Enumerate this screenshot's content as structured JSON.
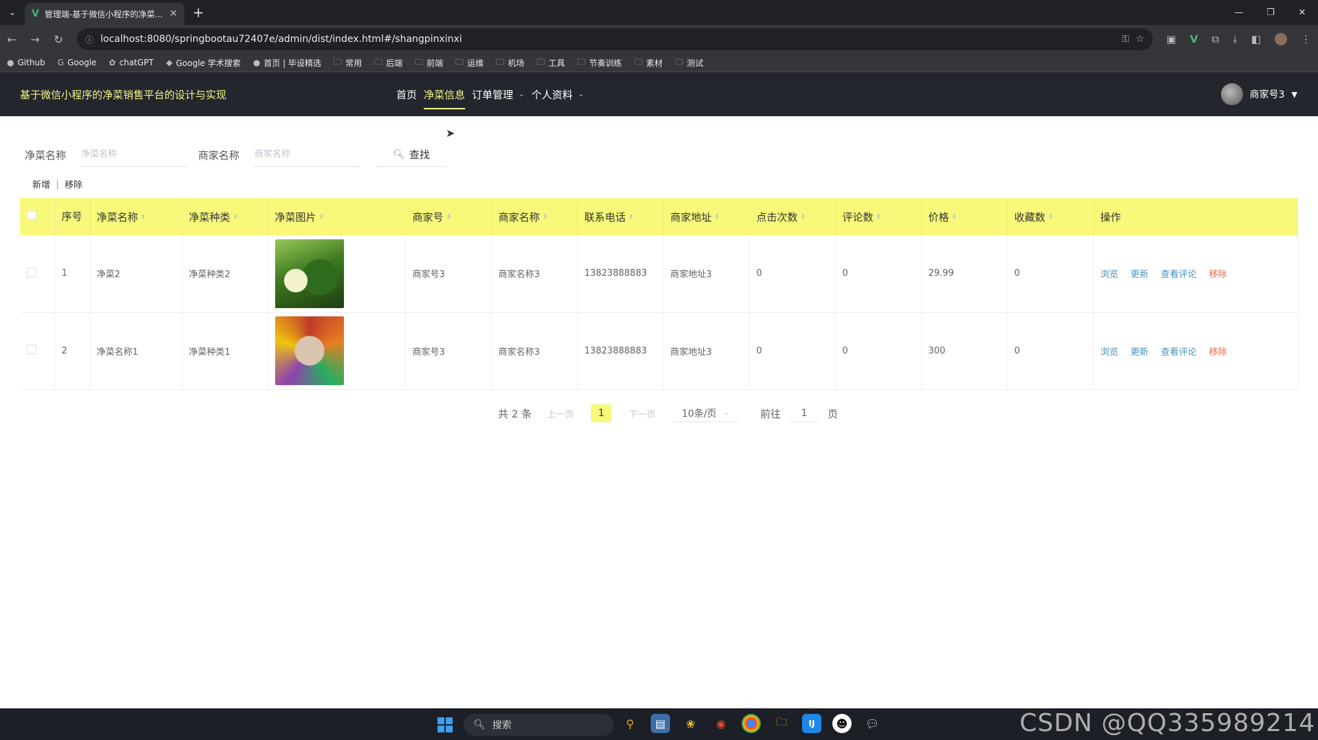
{
  "browser": {
    "tab_title": "管理端-基于微信小程序的净菜...",
    "url": "localhost:8080/springbootau72407e/admin/dist/index.html#/shangpinxinxi",
    "bookmarks": [
      "Github",
      "Google",
      "chatGPT",
      "Google 学术搜索",
      "首页 | 毕设精选",
      "常用",
      "后端",
      "前端",
      "运维",
      "机场",
      "工具",
      "节奏训练",
      "素材",
      "测试"
    ]
  },
  "app": {
    "title": "基于微信小程序的净菜销售平台的设计与实现",
    "nav": [
      "首页",
      "净菜信息",
      "订单管理",
      "个人资料"
    ],
    "user": "商家号3"
  },
  "search": {
    "label1": "净菜名称",
    "placeholder1": "净菜名称",
    "label2": "商家名称",
    "placeholder2": "商家名称",
    "button": "查找"
  },
  "actions": {
    "add": "新增",
    "remove": "移除"
  },
  "table": {
    "headers": [
      "序号",
      "净菜名称",
      "净菜种类",
      "净菜图片",
      "商家号",
      "商家名称",
      "联系电话",
      "商家地址",
      "点击次数",
      "评论数",
      "价格",
      "收藏数",
      "操作"
    ],
    "rows": [
      {
        "index": "1",
        "name": "净菜2",
        "kind": "净菜种类2",
        "shop_no": "商家号3",
        "shop_name": "商家名称3",
        "phone": "13823888883",
        "addr": "商家地址3",
        "clicks": "0",
        "comments": "0",
        "price": "29.99",
        "favs": "0"
      },
      {
        "index": "2",
        "name": "净菜名称1",
        "kind": "净菜种类1",
        "shop_no": "商家号3",
        "shop_name": "商家名称3",
        "phone": "13823888883",
        "addr": "商家地址3",
        "clicks": "0",
        "comments": "0",
        "price": "300",
        "favs": "0"
      }
    ],
    "ops": [
      "浏览",
      "更新",
      "查看评论",
      "移除"
    ]
  },
  "pager": {
    "total": "共 2 条",
    "prev": "上一页",
    "current": "1",
    "next": "下一页",
    "size": "10条/页",
    "goto": "前往",
    "goto_value": "1",
    "page_unit": "页"
  },
  "taskbar": {
    "search": "搜索"
  },
  "watermark": "CSDN @QQ335989214"
}
